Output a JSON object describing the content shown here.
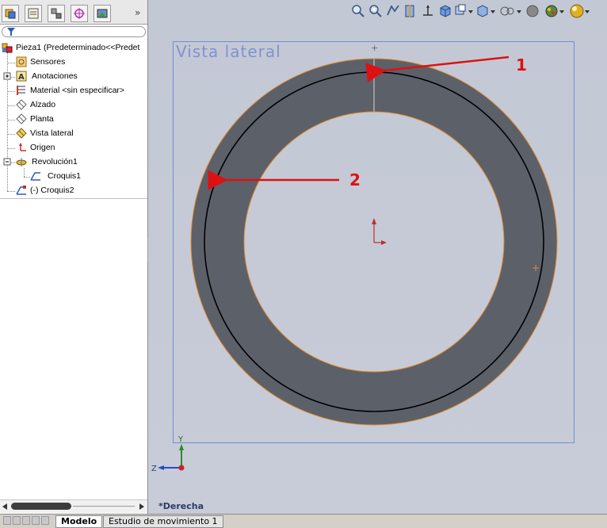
{
  "tree": {
    "items": [
      {
        "label": "Pieza1  (Predeterminado<<Predet"
      },
      {
        "label": "Sensores"
      },
      {
        "label": "Anotaciones"
      },
      {
        "label": "Material <sin especificar>"
      },
      {
        "label": "Alzado"
      },
      {
        "label": "Planta"
      },
      {
        "label": "Vista lateral"
      },
      {
        "label": "Origen"
      },
      {
        "label": "Revolución1"
      },
      {
        "label": "Croquis1"
      },
      {
        "label": "(-) Croquis2"
      }
    ]
  },
  "panel": {
    "more_label": "»"
  },
  "viewport": {
    "plane_label": "Vista lateral",
    "view_name": "*Derecha",
    "callout1": "1",
    "callout2": "2",
    "triad_y": "Y",
    "triad_z": "Z"
  },
  "bottom_tabs": [
    {
      "label": "Modelo"
    },
    {
      "label": "Estudio de movimiento 1"
    }
  ],
  "colors": {
    "ring_fill": "#5c6069",
    "viewport_bg": "#c4c9d6",
    "edge_orange": "#e08a2a",
    "arrow_red": "#dd1111",
    "plane_blue": "#7e93d1"
  }
}
